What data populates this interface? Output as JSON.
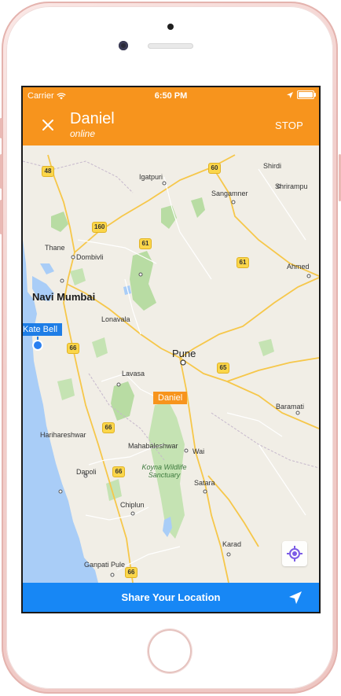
{
  "status_bar": {
    "carrier": "Carrier",
    "time": "6:50 PM"
  },
  "header": {
    "contact_name": "Daniel",
    "contact_status": "online",
    "stop_label": "STOP"
  },
  "map": {
    "pins": {
      "kate": "Kate Bell",
      "daniel": "Daniel"
    },
    "cities": {
      "shirdi": "Shirdi",
      "shrirampur": "Shrirampu",
      "igatpuri": "Igatpuri",
      "sangamner": "Sangamner",
      "thane": "Thane",
      "dombivli": "Dombivli",
      "ahmednagar": "Ahmed",
      "navi_mumbai": "Navi Mumbai",
      "lonavala": "Lonavala",
      "pune": "Pune",
      "lavasa": "Lavasa",
      "baramati": "Baramati",
      "harihareshwar": "Harihareshwar",
      "mahabaleshwar": "Mahabaleshwar",
      "wai": "Wai",
      "dapoli": "Dapoli",
      "satara": "Satara",
      "chiplun": "Chiplun",
      "karad": "Karad",
      "ganpati_pule": "Ganpati Pule"
    },
    "park": "Koyna Wildlife Sanctuary",
    "shields": {
      "s48": "48",
      "s60": "60",
      "s160": "160",
      "s61a": "61",
      "s61b": "61",
      "s66a": "66",
      "s65": "65",
      "s66b": "66",
      "s66c": "66",
      "s66d": "66"
    }
  },
  "share": {
    "label": "Share Your Location"
  },
  "colors": {
    "header": "#f7941d",
    "share_bar": "#1787f5",
    "kate_pin": "#1e7de6",
    "daniel_pin": "#f7941d",
    "water": "#a9cdf7",
    "forest": "#b8dca3",
    "road_major": "#fbd64a"
  }
}
